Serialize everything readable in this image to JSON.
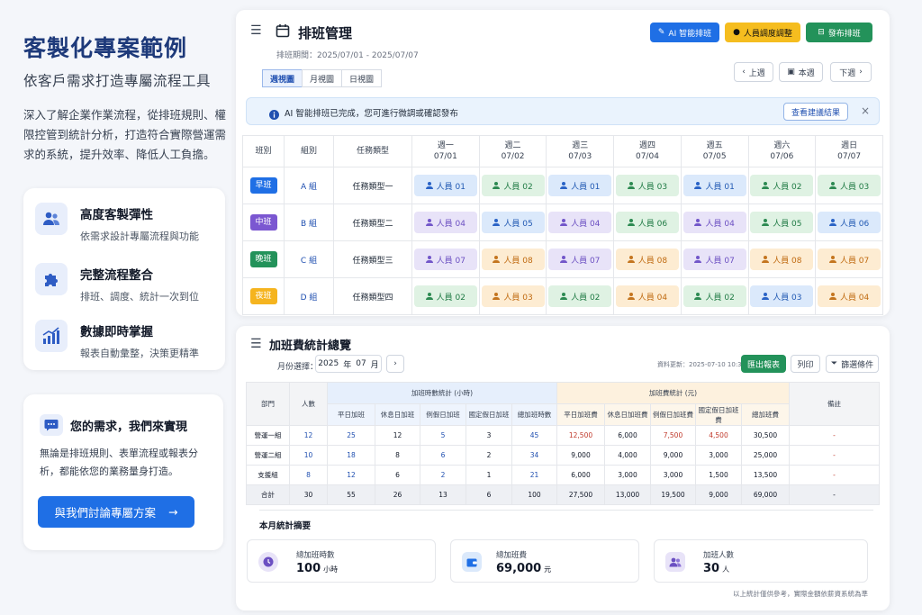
{
  "hero": {
    "title": "客製化專案範例",
    "subtitle": "依客戶需求打造專屬流程工具",
    "desc": "深入了解企業作業流程，從排班規則、權限控管到統計分析，打造符合實際營運需求的系統，提升效率、降低人工負擔。"
  },
  "features": [
    {
      "title": "高度客製彈性",
      "desc": "依需求設計專屬流程與功能",
      "icon": "people-icon"
    },
    {
      "title": "完整流程整合",
      "desc": "排班、調度、統計一次到位",
      "icon": "puzzle-icon"
    },
    {
      "title": "數據即時掌握",
      "desc": "報表自動彙整，決策更精準",
      "icon": "chart-icon"
    }
  ],
  "need": {
    "title": "您的需求，我們來實現",
    "desc": "無論是排班規則、表單流程或報表分析，都能依您的業務量身打造。",
    "cta": "與我們討論專屬方案",
    "cta_arrow": "→"
  },
  "schedule": {
    "title": "排班管理",
    "period": "排班期間：2025/07/01 - 2025/07/07",
    "btn_ai": "AI 智能排班",
    "btn_adjust": "人員調度調整",
    "btn_publish": "發布排班",
    "tabs": [
      "週視圖",
      "月視圖",
      "日視圖"
    ],
    "nav": {
      "prev": "上週",
      "current": "本週",
      "next": "下週"
    },
    "banner": {
      "text": "AI 智能排班已完成，您可進行微調或確認發布",
      "button": "查看建議結果",
      "close": "×"
    },
    "headers": {
      "shift": "班別",
      "group": "組別",
      "task": "任務類型"
    },
    "days": [
      {
        "d": "週一",
        "date": "07/01"
      },
      {
        "d": "週二",
        "date": "07/02"
      },
      {
        "d": "週三",
        "date": "07/03"
      },
      {
        "d": "週四",
        "date": "07/04"
      },
      {
        "d": "週五",
        "date": "07/05"
      },
      {
        "d": "週六",
        "date": "07/06"
      },
      {
        "d": "週日",
        "date": "07/07"
      }
    ],
    "rows": [
      {
        "shift": "早班",
        "shift_color": "#1f6fe5",
        "group": "A 組",
        "task": "任務類型一",
        "cells": [
          {
            "p": "人員 01",
            "c": "blue"
          },
          {
            "p": "人員 02",
            "c": "green"
          },
          {
            "p": "人員 01",
            "c": "blue"
          },
          {
            "p": "人員 03",
            "c": "green"
          },
          {
            "p": "人員 01",
            "c": "blue"
          },
          {
            "p": "人員 02",
            "c": "green"
          },
          {
            "p": "人員 03",
            "c": "green"
          }
        ]
      },
      {
        "shift": "中班",
        "shift_color": "#7b57d1",
        "group": "B 組",
        "task": "任務類型二",
        "cells": [
          {
            "p": "人員 04",
            "c": "purple"
          },
          {
            "p": "人員 05",
            "c": "blue"
          },
          {
            "p": "人員 04",
            "c": "purple"
          },
          {
            "p": "人員 06",
            "c": "green"
          },
          {
            "p": "人員 04",
            "c": "purple"
          },
          {
            "p": "人員 05",
            "c": "green"
          },
          {
            "p": "人員 06",
            "c": "blue"
          }
        ]
      },
      {
        "shift": "晚班",
        "shift_color": "#23925a",
        "group": "C 組",
        "task": "任務類型三",
        "cells": [
          {
            "p": "人員 07",
            "c": "purple"
          },
          {
            "p": "人員 08",
            "c": "orange"
          },
          {
            "p": "人員 07",
            "c": "purple"
          },
          {
            "p": "人員 08",
            "c": "orange"
          },
          {
            "p": "人員 07",
            "c": "purple"
          },
          {
            "p": "人員 08",
            "c": "orange"
          },
          {
            "p": "人員 07",
            "c": "orange"
          }
        ]
      },
      {
        "shift": "夜班",
        "shift_color": "#f5b41f",
        "group": "D 組",
        "task": "任務類型四",
        "cells": [
          {
            "p": "人員 02",
            "c": "green"
          },
          {
            "p": "人員 03",
            "c": "orange"
          },
          {
            "p": "人員 02",
            "c": "green"
          },
          {
            "p": "人員 04",
            "c": "orange"
          },
          {
            "p": "人員 02",
            "c": "green"
          },
          {
            "p": "人員 03",
            "c": "blue"
          },
          {
            "p": "人員 04",
            "c": "orange"
          }
        ]
      }
    ]
  },
  "overtime": {
    "title": "加班費統計總覽",
    "month_label": "月份選擇：",
    "year": "2025",
    "year_unit": "年",
    "month": "07",
    "month_unit": "月",
    "updated": "資料更新：2025-07-10 10:30",
    "btn_export": "匯出報表",
    "btn_print": "列印",
    "btn_filter": "篩選條件",
    "headers": {
      "dept": "部門",
      "count": "人數",
      "hours_group": "加班時數統計 (小時)",
      "pay_group": "加班費統計 (元)",
      "note": "備註"
    },
    "sub_headers": [
      "平日加班",
      "休息日加班",
      "例假日加班",
      "國定假日加班",
      "總加班時數",
      "平日加班費",
      "休息日加班費",
      "例假日加班費",
      "國定假日加班費",
      "總加班費"
    ],
    "rows": [
      {
        "cells": [
          "營運一組",
          "12",
          "25",
          "12",
          "5",
          "3",
          "45",
          "12,500",
          "6,000",
          "7,500",
          "4,500",
          "30,500",
          "-"
        ]
      },
      {
        "cells": [
          "營運二組",
          "10",
          "18",
          "8",
          "6",
          "2",
          "34",
          "9,000",
          "4,000",
          "9,000",
          "3,000",
          "25,000",
          "-"
        ]
      },
      {
        "cells": [
          "支援組",
          "8",
          "12",
          "6",
          "2",
          "1",
          "21",
          "6,000",
          "3,000",
          "3,000",
          "1,500",
          "13,500",
          "-"
        ]
      },
      {
        "cells": [
          "合計",
          "30",
          "55",
          "26",
          "13",
          "6",
          "100",
          "27,500",
          "13,000",
          "19,500",
          "9,000",
          "69,000",
          "-"
        ]
      }
    ],
    "summary_title": "本月統計摘要",
    "stats": [
      {
        "label": "總加班時數",
        "value": "100",
        "unit": "小時",
        "icon": "clock-icon"
      },
      {
        "label": "總加班費",
        "value": "69,000",
        "unit": "元",
        "icon": "wallet-icon"
      },
      {
        "label": "加班人數",
        "value": "30",
        "unit": "人",
        "icon": "people-icon"
      }
    ],
    "footnote": "以上統計僅供參考，實際金額依薪資系統為準"
  }
}
